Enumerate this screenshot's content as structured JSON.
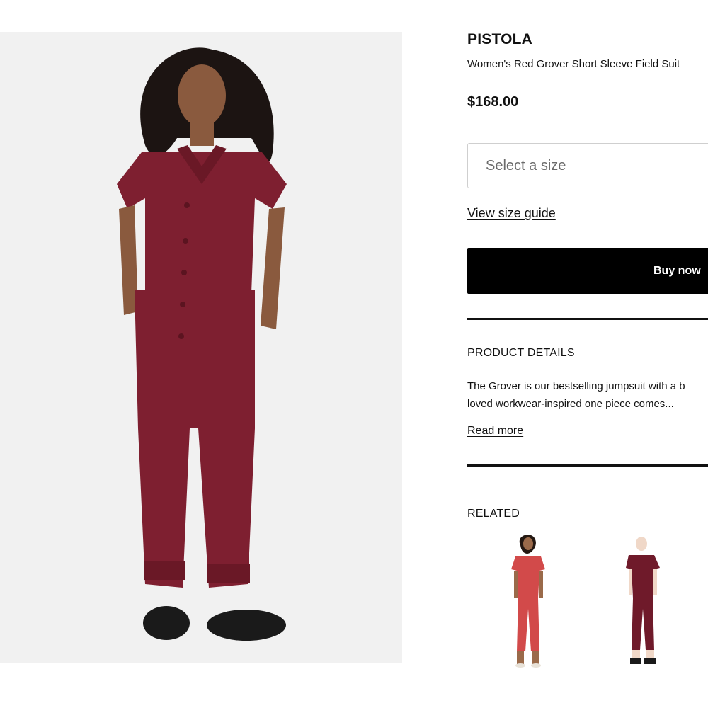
{
  "product": {
    "brand": "PISTOLA",
    "name": "Women's Red Grover Short Sleeve Field Suit",
    "price": "$168.00"
  },
  "size_select": {
    "placeholder": "Select a size"
  },
  "links": {
    "size_guide": "View size guide",
    "read_more": "Read more"
  },
  "buy_button": {
    "label": "Buy now"
  },
  "product_details": {
    "title": "PRODUCT DETAILS",
    "line_1": "The Grover is our bestselling jumpsuit with a b",
    "line_2": "loved workwear-inspired one piece comes..."
  },
  "related": {
    "title": "RELATED",
    "items": [
      {
        "color": "#d24a4a"
      },
      {
        "color": "#6f1a2a"
      }
    ]
  },
  "colors": {
    "jumpsuit": "#7e1f30",
    "background": "#f1f1f1",
    "button": "#000000",
    "button_text": "#ffffff"
  }
}
